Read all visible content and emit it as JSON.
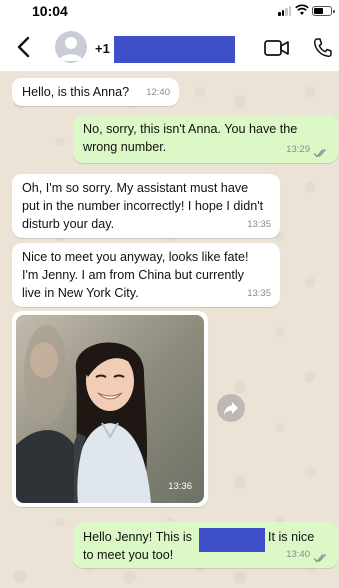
{
  "status_bar": {
    "time": "10:04"
  },
  "header": {
    "phone_prefix": "+1",
    "phone_redacted": true
  },
  "messages": [
    {
      "text": "Hello, is this Anna?",
      "time": "12:40",
      "direction": "incoming"
    },
    {
      "text": "No, sorry, this isn't Anna. You have the wrong number.",
      "time": "13:29",
      "direction": "outgoing",
      "status": "read"
    },
    {
      "text": "Oh, I'm so sorry. My assistant must have put in the number incorrectly! I hope I didn't disturb your day.",
      "time": "13:35",
      "direction": "incoming"
    },
    {
      "text": "Nice to meet you anyway, looks like fate! I'm Jenny. I am from China but currently live in New York City.",
      "time": "13:35",
      "direction": "incoming"
    },
    {
      "type": "photo",
      "time": "13:36",
      "direction": "incoming"
    },
    {
      "text_before": "Hello Jenny! This is",
      "text_after": "It is nice",
      "text_line2": "to meet you too!",
      "time": "13:40",
      "direction": "outgoing",
      "status": "read"
    }
  ],
  "colors": {
    "incoming_bubble": "#ffffff",
    "outgoing_bubble": "#dcf8c6",
    "chat_background": "#ebe3d6",
    "redaction": "#3f4fc9",
    "read_ticks": "#8a8a8a"
  },
  "icons": {
    "back": "chevron-left-icon",
    "avatar": "person-avatar-icon",
    "video": "video-camera-icon",
    "call": "phone-icon",
    "forward": "forward-icon",
    "read_status": "double-check-icon"
  }
}
